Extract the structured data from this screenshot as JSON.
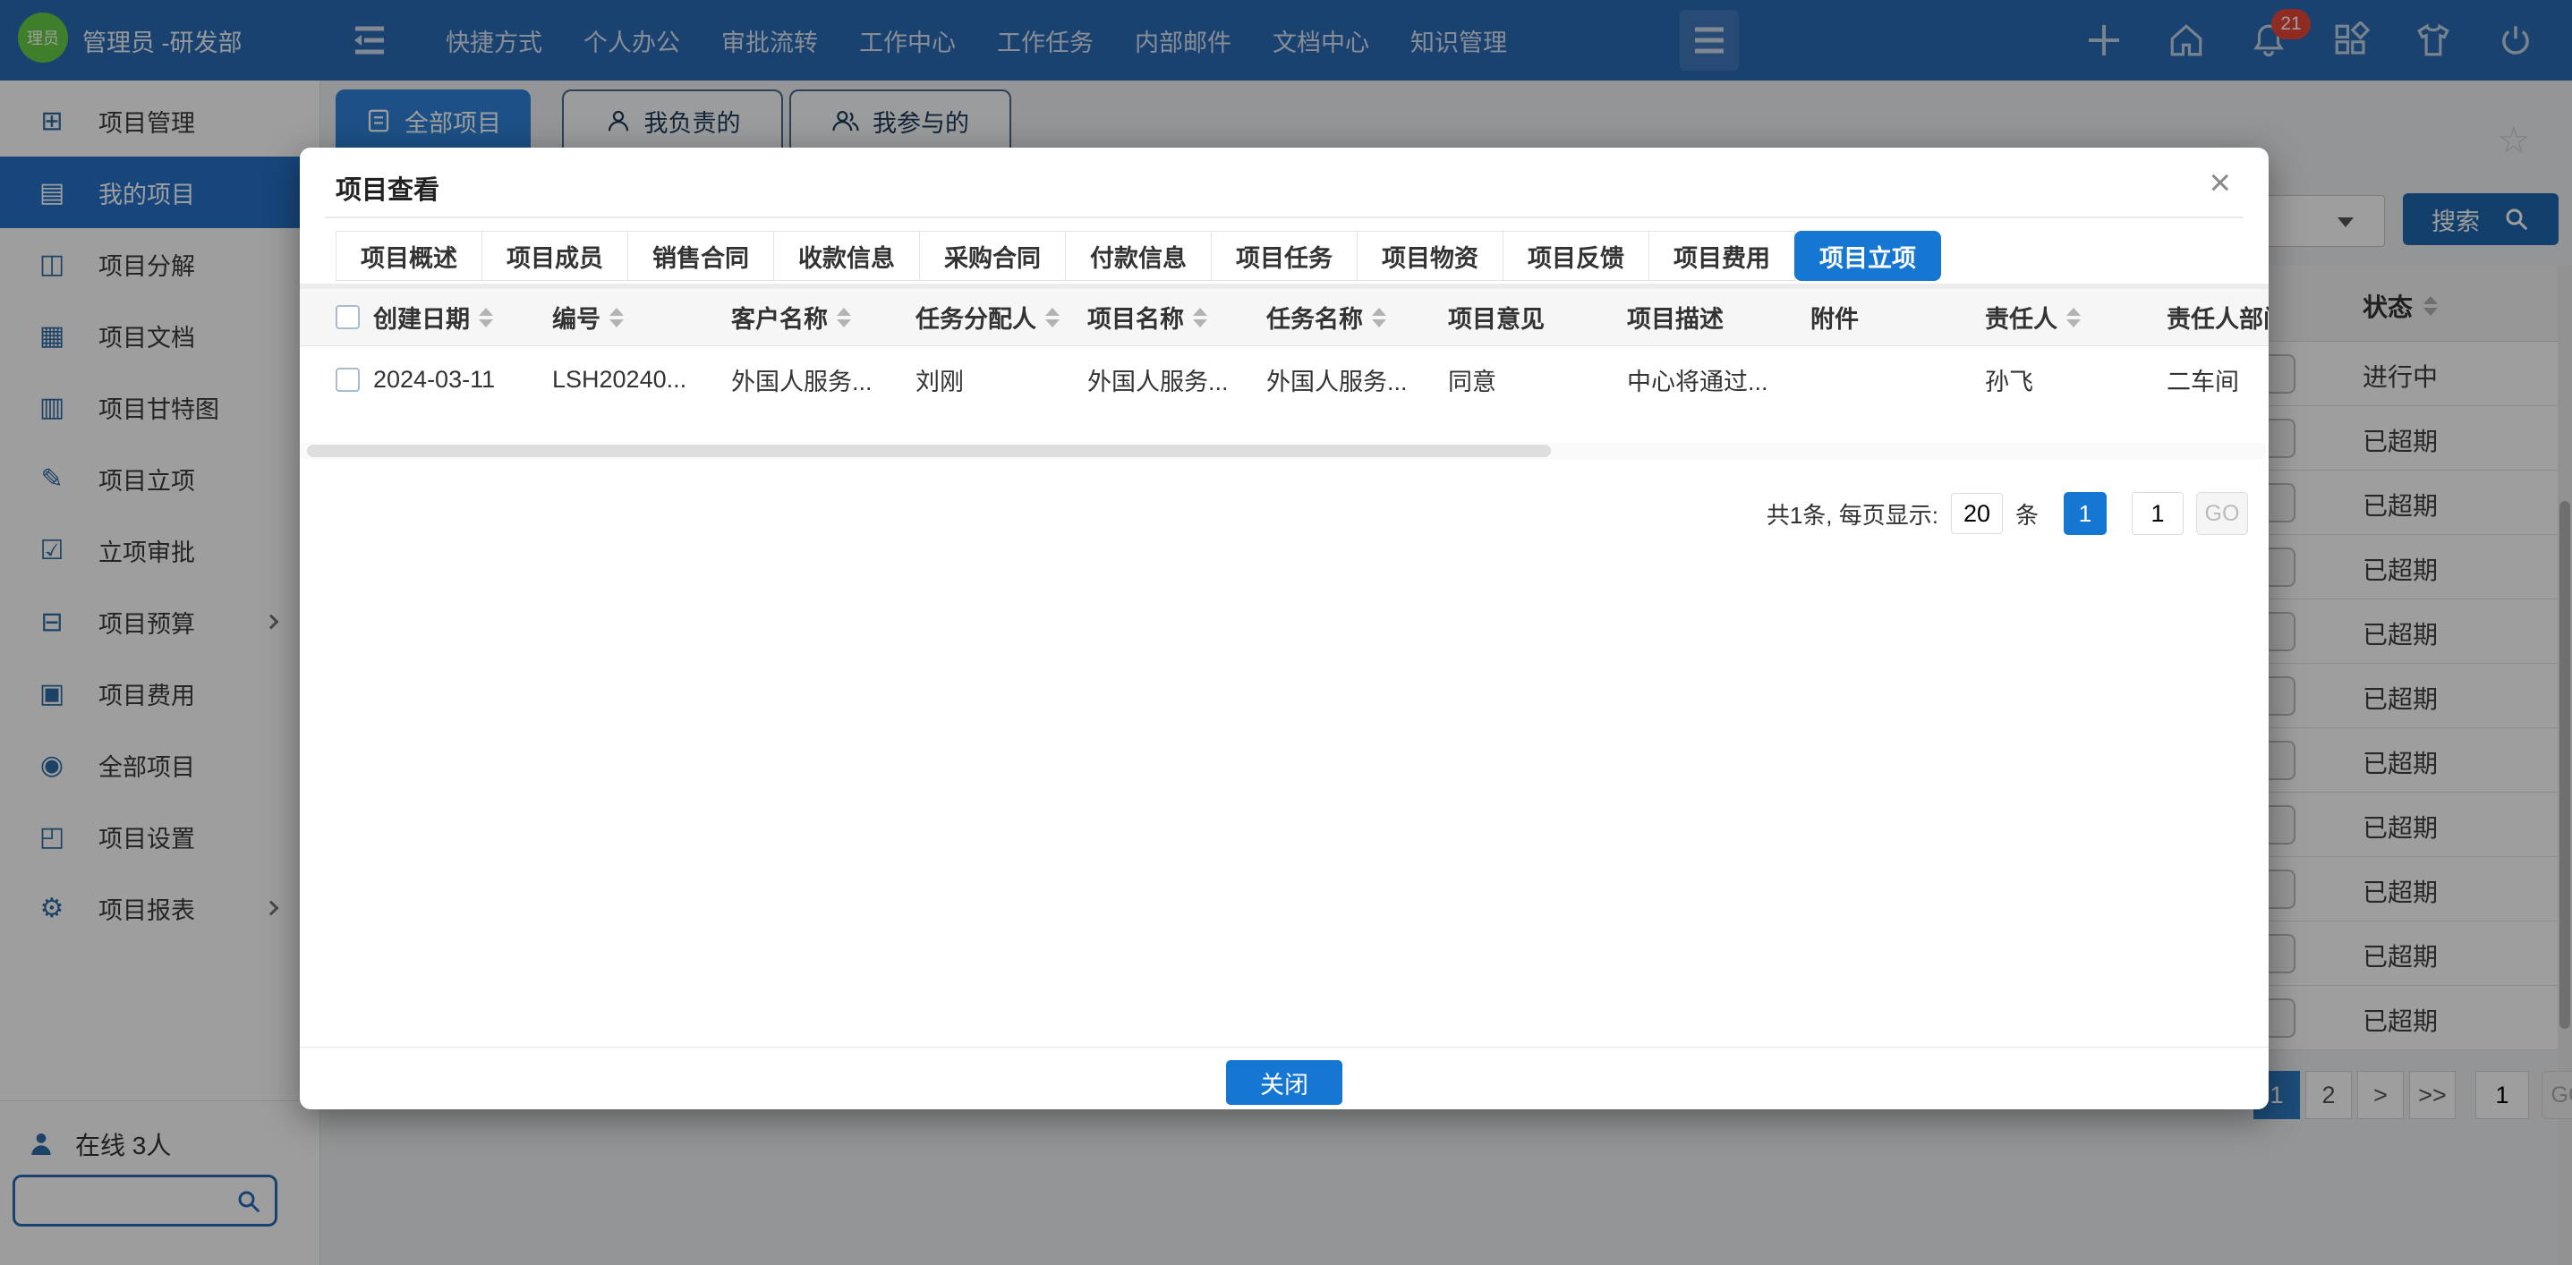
{
  "topbar": {
    "avatar_text": "理员",
    "user_name": "管理员 -研发部",
    "menu": [
      "快捷方式",
      "个人办公",
      "审批流转",
      "工作中心",
      "工作任务",
      "内部邮件",
      "文档中心",
      "知识管理"
    ],
    "notification_count": "21"
  },
  "sidebar": {
    "items": [
      {
        "label": "项目管理",
        "active": false
      },
      {
        "label": "我的项目",
        "active": true
      },
      {
        "label": "项目分解",
        "active": false
      },
      {
        "label": "项目文档",
        "active": false
      },
      {
        "label": "项目甘特图",
        "active": false
      },
      {
        "label": "项目立项",
        "active": false
      },
      {
        "label": "立项审批",
        "active": false
      },
      {
        "label": "项目预算",
        "active": false,
        "has_submenu": true
      },
      {
        "label": "项目费用",
        "active": false
      },
      {
        "label": "全部项目",
        "active": false
      },
      {
        "label": "项目设置",
        "active": false
      },
      {
        "label": "项目报表",
        "active": false,
        "has_submenu": true
      }
    ],
    "icons": [
      "⊞",
      "▤",
      "◫",
      "▦",
      "▥",
      "✎",
      "☑",
      "⊟",
      "▣",
      "◉",
      "◰",
      "⚙"
    ]
  },
  "online": {
    "label": "在线 3人"
  },
  "background": {
    "filters": [
      "全部项目",
      "我负责的",
      "我参与的"
    ],
    "star_icon": "☆",
    "search_button": "搜索",
    "status_header": "状态",
    "rows": [
      "进行中",
      "已超期",
      "已超期",
      "已超期",
      "已超期",
      "已超期",
      "已超期",
      "已超期",
      "已超期",
      "已超期",
      "已超期"
    ],
    "pagination": {
      "page_current": "1",
      "page_2": "2",
      "next": ">",
      "last": ">>",
      "jump_value": "1",
      "go": "GO"
    }
  },
  "modal": {
    "title": "项目查看",
    "close_icon": "×",
    "tabs": [
      "项目概述",
      "项目成员",
      "销售合同",
      "收款信息",
      "采购合同",
      "付款信息",
      "项目任务",
      "项目物资",
      "项目反馈",
      "项目费用",
      "项目立项"
    ],
    "active_tab": "项目立项",
    "table": {
      "columns": [
        "创建日期",
        "编号",
        "客户名称",
        "任务分配人",
        "项目名称",
        "任务名称",
        "项目意见",
        "项目描述",
        "附件",
        "责任人",
        "责任人部门"
      ],
      "rows": [
        [
          "2024-03-11",
          "LSH20240...",
          "外国人服务...",
          "刘刚",
          "外国人服务...",
          "外国人服务...",
          "同意",
          "中心将通过...",
          "",
          "孙飞",
          "二车间"
        ]
      ]
    },
    "pagination": {
      "summary": "共1条, 每页显示:",
      "page_size": "20",
      "unit": "条",
      "page_current": "1",
      "jump_value": "1",
      "go": "GO"
    },
    "close_button": "关闭"
  },
  "colors": {
    "accent_blue": "#1677d2",
    "topbar_blue": "#2a6bb5",
    "active_item_blue": "#2471c8",
    "badge_red": "#e8463a",
    "avatar_green": "#67cc44"
  }
}
